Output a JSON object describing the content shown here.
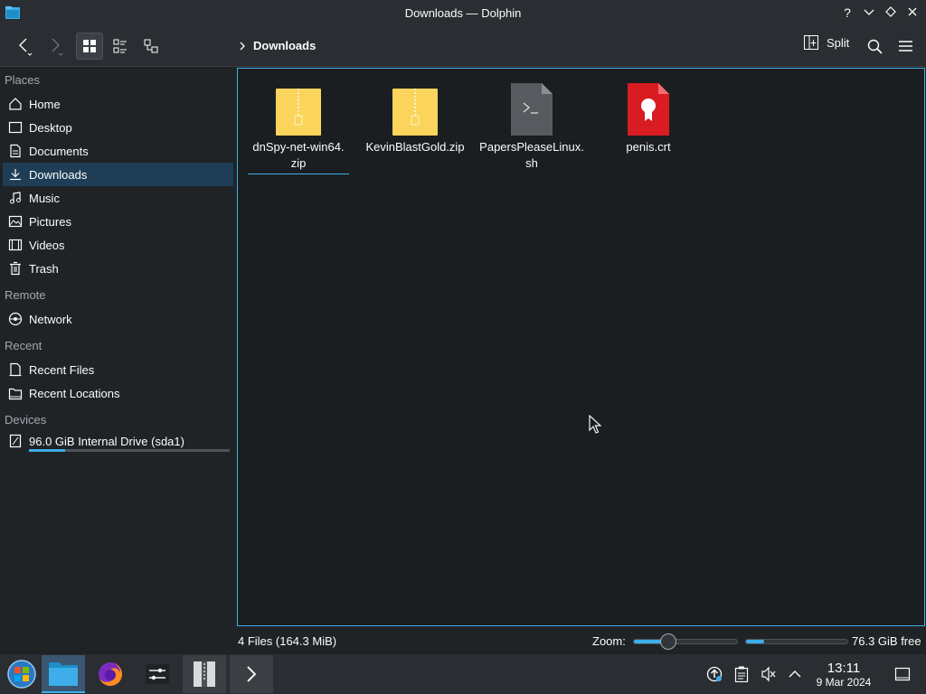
{
  "window": {
    "title": "Downloads — Dolphin"
  },
  "titlebar": {
    "help_symbol": "?"
  },
  "toolbar": {
    "breadcrumb": "Downloads",
    "split_label": "Split"
  },
  "sidebar": {
    "sections": {
      "places": "Places",
      "remote": "Remote",
      "recent": "Recent",
      "devices": "Devices"
    },
    "places": [
      "Home",
      "Desktop",
      "Documents",
      "Downloads",
      "Music",
      "Pictures",
      "Videos",
      "Trash"
    ],
    "selected": "Downloads",
    "remote": [
      "Network"
    ],
    "recent": [
      "Recent Files",
      "Recent Locations"
    ],
    "devices": [
      {
        "label": "96.0 GiB Internal Drive (sda1)",
        "used_fraction": 0.18
      }
    ]
  },
  "files": [
    {
      "name": "dnSpy-net-win64.zip",
      "line1": "dnSpy-net-win64.",
      "line2": "zip",
      "type": "zip-icon"
    },
    {
      "name": "KevinBlastGold.zip",
      "line1": "KevinBlastGold.zip",
      "line2": "",
      "type": "zip-icon"
    },
    {
      "name": "PapersPleaseLinux.sh",
      "line1": "PapersPleaseLinux.",
      "line2": "sh",
      "type": "script-icon"
    },
    {
      "name": "penis.crt",
      "line1": "penis.crt",
      "line2": "",
      "type": "certificate-icon"
    }
  ],
  "statusbar": {
    "count": "4 Files (164.3 MiB)",
    "zoom_label": "Zoom:",
    "zoom_level": 0.3,
    "free_space": "76.3 GiB free",
    "used_fraction": 0.18
  },
  "taskbar": {
    "time": "13:11",
    "date": "9 Mar 2024"
  },
  "colors": {
    "accent": "#3daee9",
    "selection": "#1d3e56",
    "folder_yellow": "#fbd45c",
    "cert_red": "#d81c21"
  }
}
